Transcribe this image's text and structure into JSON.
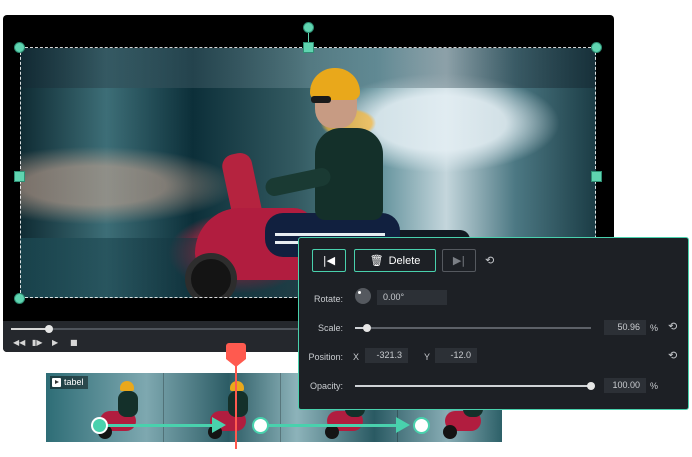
{
  "timeline": {
    "clip_label": "tabel"
  },
  "panel": {
    "buttons": {
      "prev_keyframe_icon": "K",
      "delete_label": "Delete",
      "next_keyframe_icon": "K"
    },
    "rotate": {
      "label": "Rotate:",
      "value": "0.00°"
    },
    "scale": {
      "label": "Scale:",
      "value": "50.96",
      "unit": "%",
      "level": 0.05
    },
    "position": {
      "label": "Position:",
      "x_label": "X",
      "x_value": "-321.3",
      "y_label": "Y",
      "y_value": "-12.0"
    },
    "opacity": {
      "label": "Opacity:",
      "value": "100.00",
      "unit": "%",
      "level": 1.0
    }
  },
  "player": {
    "progress": 0.12,
    "controls": [
      "prev-frame",
      "step",
      "play",
      "stop"
    ]
  },
  "colors": {
    "accent": "#49d1ad",
    "playhead": "#ff5a4f",
    "panel_bg": "#1d2025"
  }
}
